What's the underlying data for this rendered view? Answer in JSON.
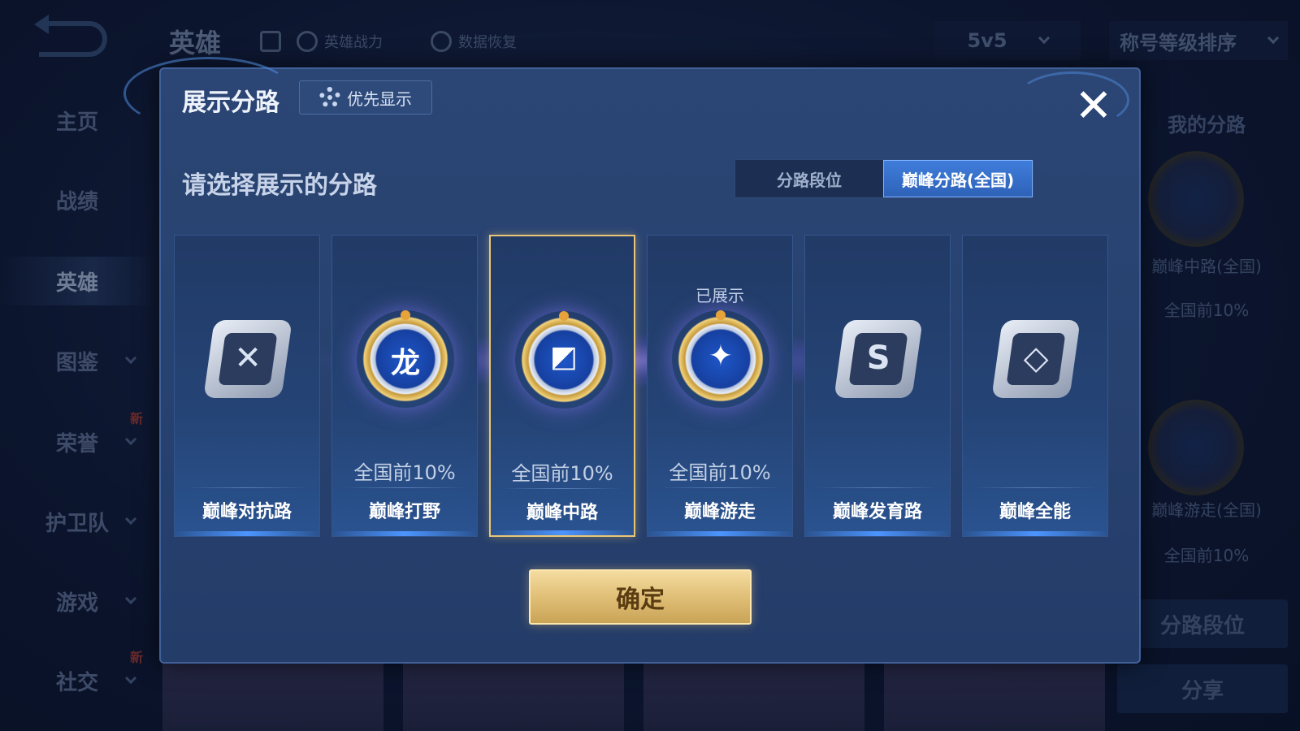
{
  "background": {
    "title": "英雄",
    "tools": [
      "英雄战力",
      "数据恢复"
    ],
    "mode_select": "5v5",
    "sort_select": "称号等级排序",
    "sidebar": [
      {
        "label": "主页",
        "active": false,
        "chevron": false,
        "badge": ""
      },
      {
        "label": "战绩",
        "active": false,
        "chevron": false,
        "badge": ""
      },
      {
        "label": "英雄",
        "active": true,
        "chevron": false,
        "badge": ""
      },
      {
        "label": "图鉴",
        "active": false,
        "chevron": true,
        "badge": ""
      },
      {
        "label": "荣誉",
        "active": false,
        "chevron": true,
        "badge": "新"
      },
      {
        "label": "护卫队",
        "active": false,
        "chevron": true,
        "badge": ""
      },
      {
        "label": "游戏",
        "active": false,
        "chevron": true,
        "badge": ""
      },
      {
        "label": "社交",
        "active": false,
        "chevron": true,
        "badge": "新"
      }
    ],
    "right_panel": {
      "title": "我的分路",
      "entries": [
        {
          "name": "巅峰中路(全国)",
          "rank": "全国前10%"
        },
        {
          "name": "巅峰游走(全国)",
          "rank": "全国前10%"
        }
      ],
      "lane_rank_button": "分路段位",
      "share_button": "分享"
    }
  },
  "dialog": {
    "title": "展示分路",
    "priority_button": "优先显示",
    "subtitle": "请选择展示的分路",
    "tabs": [
      {
        "label": "分路段位",
        "active": false
      },
      {
        "label": "巅峰分路(全国)",
        "active": true
      }
    ],
    "lanes": [
      {
        "name": "巅峰对抗路",
        "rank": "",
        "shown": "",
        "selected": false,
        "emblem": "plain",
        "glyph": "✕",
        "icon": "sword-cross-icon"
      },
      {
        "name": "巅峰打野",
        "rank": "全国前10%",
        "shown": "",
        "selected": false,
        "emblem": "gold",
        "glyph": "龙",
        "icon": "dragon-icon"
      },
      {
        "name": "巅峰中路",
        "rank": "全国前10%",
        "shown": "",
        "selected": true,
        "emblem": "gold",
        "glyph": "◩",
        "icon": "mid-lane-icon"
      },
      {
        "name": "巅峰游走",
        "rank": "全国前10%",
        "shown": "已展示",
        "selected": false,
        "emblem": "gold",
        "glyph": "✦",
        "icon": "wings-icon"
      },
      {
        "name": "巅峰发育路",
        "rank": "",
        "shown": "",
        "selected": false,
        "emblem": "plain",
        "glyph": "S",
        "icon": "marksman-icon"
      },
      {
        "name": "巅峰全能",
        "rank": "",
        "shown": "",
        "selected": false,
        "emblem": "plain",
        "glyph": "◇",
        "icon": "all-round-icon"
      }
    ],
    "confirm_button": "确定"
  },
  "colors": {
    "dialog_bg": "#284270",
    "selected_border": "#e9c675",
    "tab_active": "#3f7ddb",
    "confirm_gold": "#e0bf77"
  }
}
